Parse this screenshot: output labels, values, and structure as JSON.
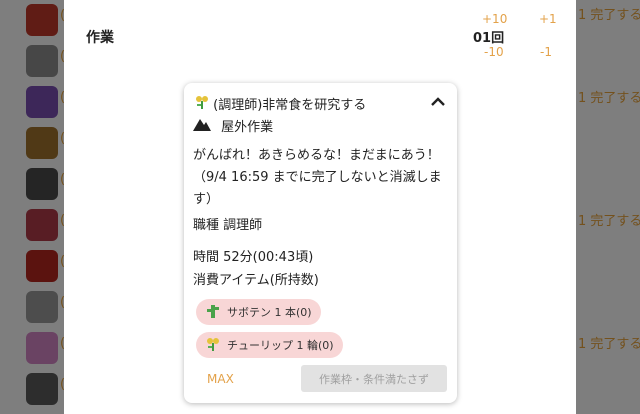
{
  "background": {
    "paren": "(",
    "right_label": "1 完了する",
    "rows": [
      {
        "icon": "tomato-icon",
        "color": "#c0392b",
        "right": true
      },
      {
        "icon": "helmet-icon",
        "color": "#8e8e8e",
        "right": false
      },
      {
        "icon": "book-icon",
        "color": "#7a4fb3",
        "right": true
      },
      {
        "icon": "plant-pot-icon",
        "color": "#a0722d",
        "right": false
      },
      {
        "icon": "furnace-icon",
        "color": "#4b4b4b",
        "right": false
      },
      {
        "icon": "potion-icon",
        "color": "#b03a48",
        "right": true
      },
      {
        "icon": "berry-icon",
        "color": "#b7261f",
        "right": false
      },
      {
        "icon": "bucket-icon",
        "color": "#9a9a9a",
        "right": false
      },
      {
        "icon": "pink-item-icon",
        "color": "#d487c7",
        "right": true
      },
      {
        "icon": "round-item-icon",
        "color": "#5b5b5b",
        "right": false
      }
    ]
  },
  "panel": {
    "title": "作業",
    "plus10": "+10",
    "plus1": "+1",
    "quantity": "01回",
    "minus10": "-10",
    "minus1": "-1"
  },
  "task": {
    "title": "(調理師)非常食を研究する",
    "location": "屋外作業",
    "description": "がんばれ！あきらめるな！まだまにあう！（9/4 16:59 までに完了しないと消滅します）",
    "job": "職種 調理師",
    "time": "時間 52分(00:43頃)",
    "consume_label": "消費アイテム(所持数)",
    "items": [
      {
        "name": "サボテン 1 本(0)",
        "icon": "cactus-icon"
      },
      {
        "name": "チューリップ 1 輪(0)",
        "icon": "tulip-icon"
      }
    ],
    "max_label": "MAX",
    "submit_label": "作業枠・条件満たさず"
  },
  "colors": {
    "accent": "#e3a24a",
    "chip_bg": "#f8d6d6",
    "disabled_bg": "#e2e2e2"
  }
}
